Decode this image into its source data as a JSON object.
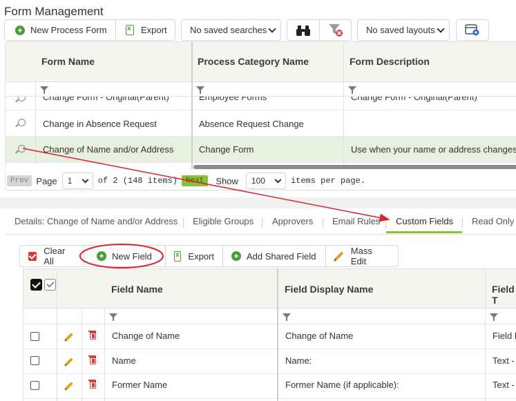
{
  "page": {
    "title": "Form Management"
  },
  "toolbar": {
    "new_process_form": "New Process Form",
    "export": "Export",
    "saved_searches": "No saved searches",
    "saved_layouts": "No saved layouts"
  },
  "forms_grid": {
    "columns": [
      "Form Name",
      "Process Category Name",
      "Form Description"
    ],
    "rows": [
      {
        "name": "Change Form - Original(Parent)",
        "category": "Employee Forms",
        "description": "Change Form - Original(Parent)"
      },
      {
        "name": "Change in Absence Request",
        "category": "Absence Request Change",
        "description": ""
      },
      {
        "name": "Change of Name and/or Address",
        "category": "Change Form",
        "description": "Use when your name or address changes"
      }
    ]
  },
  "pager": {
    "prev": "Prev",
    "page_label": "Page",
    "page_value": "1",
    "of_text": "of 2 (148 items)",
    "next": "Next",
    "show_label": "Show",
    "per_page": "100",
    "items_per_page": "items per page."
  },
  "tabs": [
    "Details: Change of Name and/or Address",
    "Eligible Groups",
    "Approvers",
    "Email Rules",
    "Custom Fields",
    "Read Only C"
  ],
  "active_tab": "Custom Fields",
  "fields_toolbar": {
    "clear_all": "Clear All",
    "new_field": "New Field",
    "export": "Export",
    "add_shared_field": "Add Shared Field",
    "mass_edit": "Mass Edit"
  },
  "fields_grid": {
    "columns": [
      "Field Name",
      "Field Display Name",
      "Field T"
    ],
    "rows": [
      {
        "name": "Change of Name",
        "display": "Change of Name",
        "type": "Field E"
      },
      {
        "name": "Name",
        "display": "Name:",
        "type": "Text -"
      },
      {
        "name": "Former Name",
        "display": "Former Name (if applicable):",
        "type": "Text -"
      }
    ]
  },
  "colors": {
    "accent_green": "#8bbf3c",
    "annotation_red": "#d9262c",
    "header_bg": "#f3f5ee"
  }
}
